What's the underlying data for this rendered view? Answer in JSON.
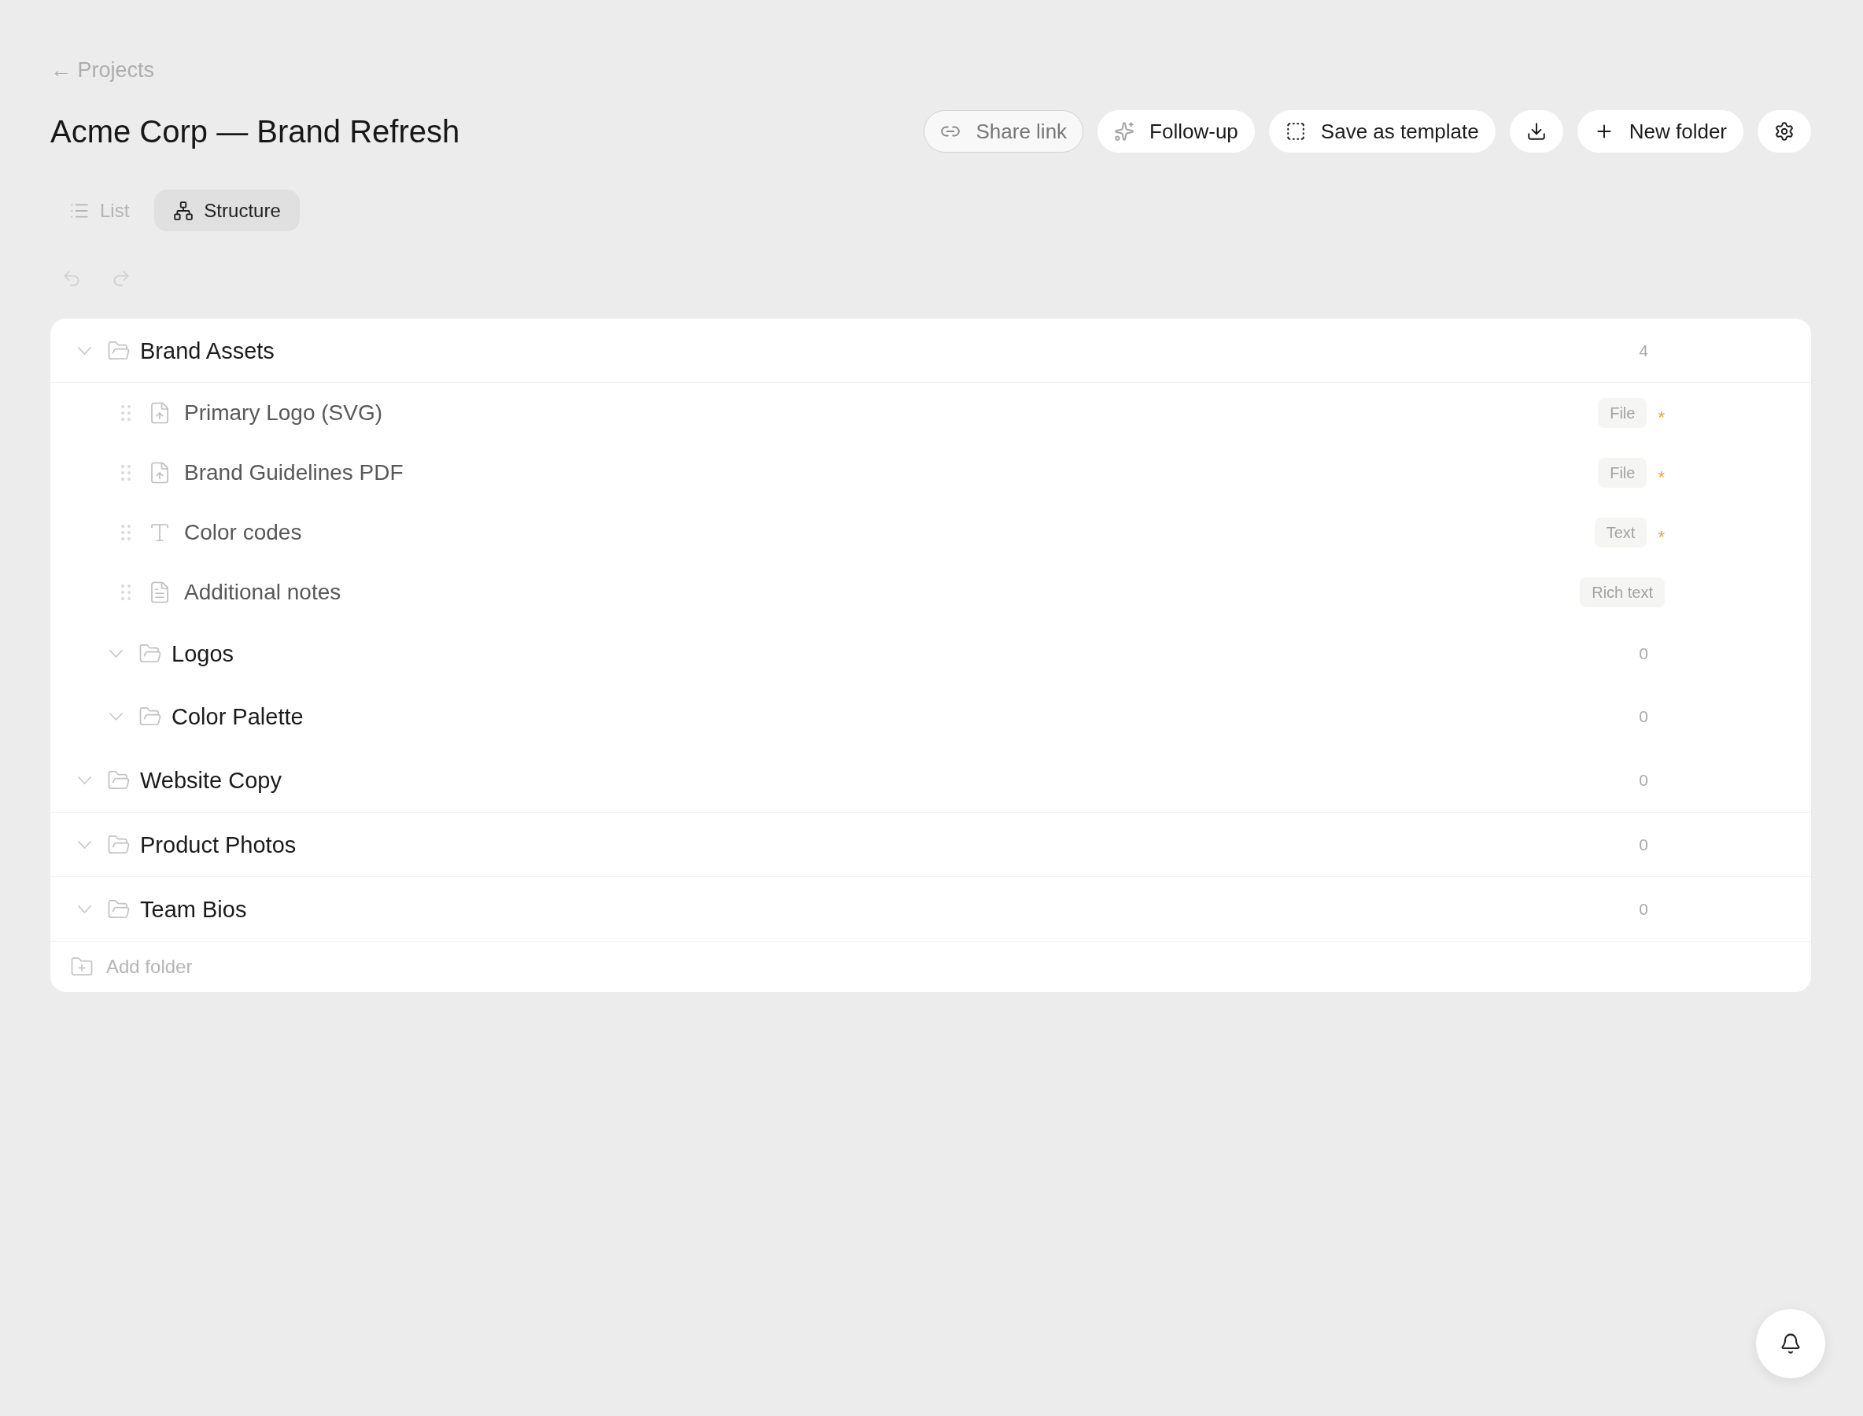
{
  "back_link": {
    "label": "← Projects"
  },
  "title": "Acme Corp — Brand Refresh",
  "actions": [
    {
      "kind": "share",
      "label": "Share link"
    },
    {
      "kind": "follow-up",
      "label": "Follow-up"
    },
    {
      "kind": "template",
      "label": "Save as template"
    },
    {
      "kind": "download"
    },
    {
      "kind": "new-folder",
      "label": "New folder"
    },
    {
      "kind": "settings"
    }
  ],
  "view_tabs": [
    {
      "kind": "list",
      "label": "List",
      "selected": false
    },
    {
      "kind": "structure",
      "label": "Structure",
      "selected": true
    }
  ],
  "history": [
    {
      "kind": "undo",
      "disabled": true
    },
    {
      "kind": "redo",
      "disabled": true
    }
  ],
  "folders": [
    {
      "kind": "folder",
      "name": "Brand Assets",
      "expanded": true,
      "count": "4",
      "children": [
        {
          "kind": "file",
          "name": "Primary Logo (SVG)",
          "type_label": "File",
          "required_mark": "*"
        },
        {
          "kind": "file",
          "name": "Brand Guidelines PDF",
          "type_label": "File",
          "required_mark": "*"
        },
        {
          "kind": "text",
          "name": "Color codes",
          "type_label": "Text",
          "required_mark": "*"
        },
        {
          "kind": "rich-text",
          "name": "Additional notes",
          "type_label": "Rich text"
        },
        {
          "kind": "folder",
          "name": "Logos",
          "expanded": true,
          "count": "0"
        },
        {
          "kind": "folder",
          "name": "Color Palette",
          "expanded": true,
          "count": "0"
        }
      ]
    },
    {
      "kind": "folder",
      "name": "Website Copy",
      "expanded": true,
      "count": "0"
    },
    {
      "kind": "folder",
      "name": "Product Photos",
      "expanded": true,
      "count": "0"
    },
    {
      "kind": "folder",
      "name": "Team Bios",
      "expanded": true,
      "count": "0"
    }
  ],
  "add_folder": {
    "label": "Add folder"
  }
}
